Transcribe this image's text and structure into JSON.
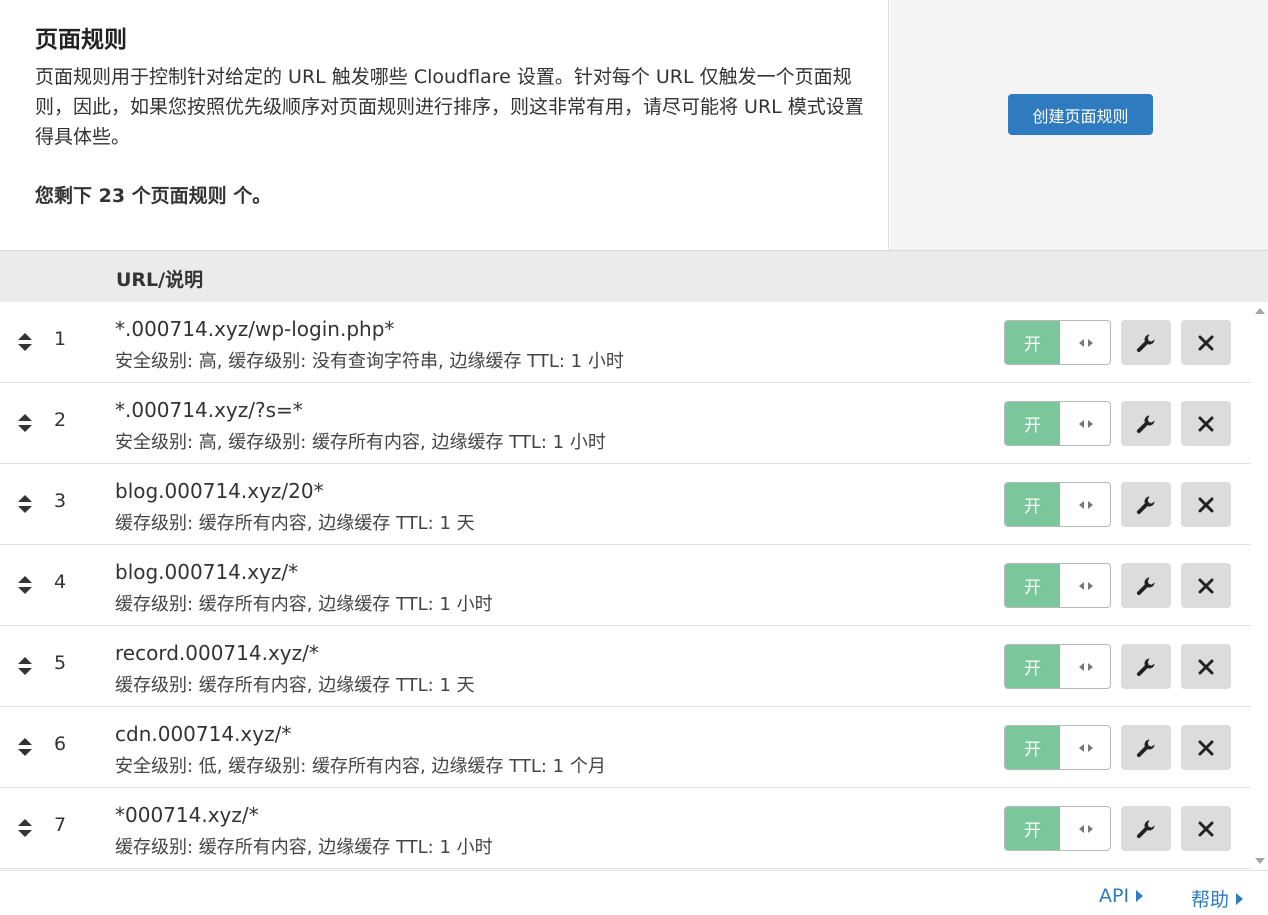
{
  "header": {
    "title": "页面规则",
    "description": "页面规则用于控制针对给定的 URL 触发哪些 Cloudflare 设置。针对每个 URL 仅触发一个页面规则，因此，如果您按照优先级顺序对页面规则进行排序，则这非常有用，请尽可能将 URL 模式设置得具体些。",
    "remaining": "您剩下 23 个页面规则 个。",
    "create_button": "创建页面规则"
  },
  "table": {
    "column_header": "URL/说明",
    "toggle_on_label": "开",
    "rows": [
      {
        "num": "1",
        "url": "*.000714.xyz/wp-login.php*",
        "settings": "安全级别: 高, 缓存级别: 没有查询字符串, 边缘缓存 TTL: 1 小时"
      },
      {
        "num": "2",
        "url": "*.000714.xyz/?s=*",
        "settings": "安全级别: 高, 缓存级别: 缓存所有内容, 边缘缓存 TTL: 1 小时"
      },
      {
        "num": "3",
        "url": "blog.000714.xyz/20*",
        "settings": "缓存级别: 缓存所有内容, 边缘缓存 TTL: 1 天"
      },
      {
        "num": "4",
        "url": "blog.000714.xyz/*",
        "settings": "缓存级别: 缓存所有内容, 边缘缓存 TTL: 1 小时"
      },
      {
        "num": "5",
        "url": "record.000714.xyz/*",
        "settings": "缓存级别: 缓存所有内容, 边缘缓存 TTL: 1 天"
      },
      {
        "num": "6",
        "url": "cdn.000714.xyz/*",
        "settings": "安全级别: 低, 缓存级别: 缓存所有内容, 边缘缓存 TTL: 1 个月"
      },
      {
        "num": "7",
        "url": "*000714.xyz/*",
        "settings": "缓存级别: 缓存所有内容, 边缘缓存 TTL: 1 小时"
      }
    ]
  },
  "footer": {
    "api_link": "API",
    "help_link": "帮助"
  },
  "icons": {
    "drag": "drag-handle-icon",
    "toggle_handle": "toggle-handle-icon",
    "edit": "wrench-icon",
    "delete": "close-icon"
  },
  "colors": {
    "accent": "#2f7bbf",
    "toggle_on": "#7cc69b",
    "icon_button_bg": "#dcdcdc"
  }
}
